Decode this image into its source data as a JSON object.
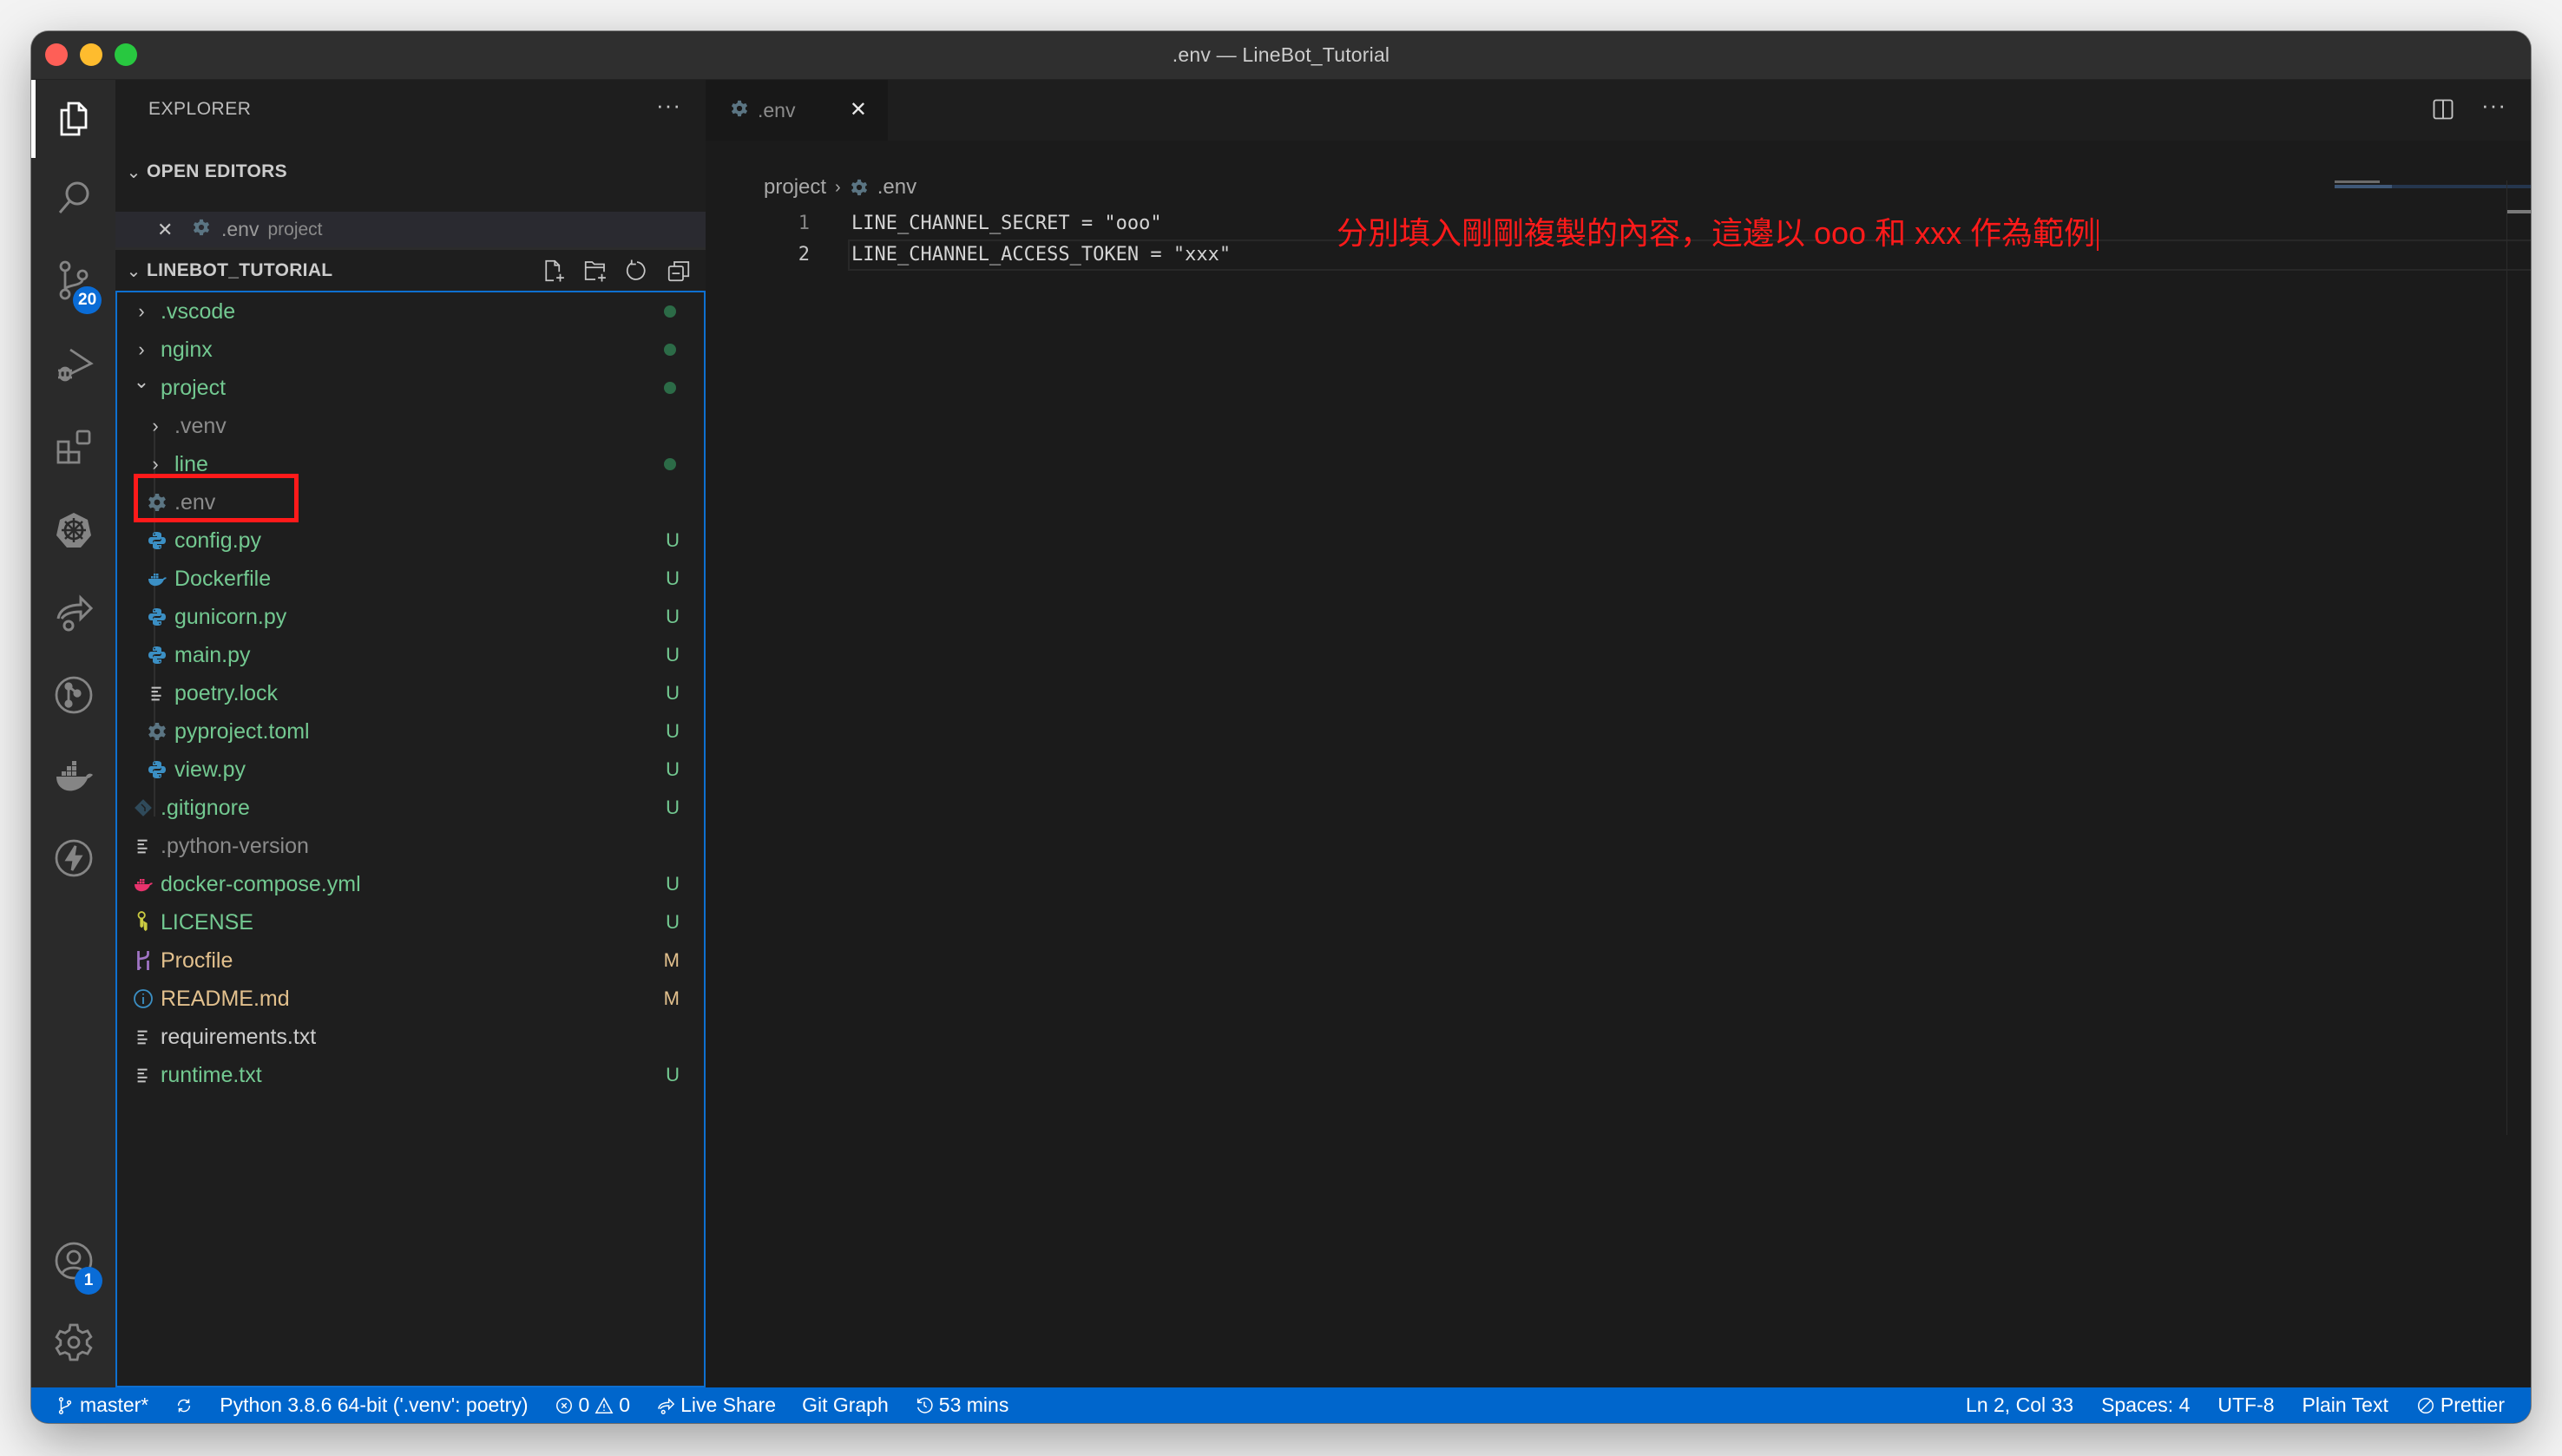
{
  "window": {
    "title": ".env — LineBot_Tutorial"
  },
  "activity_bar": {
    "items": [
      {
        "name": "explorer",
        "icon": "files-icon",
        "active": true
      },
      {
        "name": "search",
        "icon": "search-icon"
      },
      {
        "name": "source-control",
        "icon": "source-control-icon",
        "badge": "20"
      },
      {
        "name": "run-and-debug",
        "icon": "debug-icon"
      },
      {
        "name": "extensions",
        "icon": "extensions-icon"
      },
      {
        "name": "kubernetes",
        "icon": "kubernetes-icon"
      },
      {
        "name": "live-share",
        "icon": "live-share-icon"
      },
      {
        "name": "git-graph",
        "icon": "git-graph-icon"
      },
      {
        "name": "docker",
        "icon": "docker-icon"
      },
      {
        "name": "thunder-client",
        "icon": "lightning-icon"
      }
    ],
    "bottom": [
      {
        "name": "accounts",
        "icon": "account-icon",
        "badge": "1"
      },
      {
        "name": "manage",
        "icon": "gear-icon"
      }
    ]
  },
  "sidebar": {
    "title": "EXPLORER",
    "more": "···",
    "open_editors": {
      "label": "OPEN EDITORS",
      "items": [
        {
          "name": ".env",
          "description": "project",
          "close": "✕"
        }
      ]
    },
    "workspace": {
      "label": "LINEBOT_TUTORIAL",
      "actions": [
        "new-file",
        "new-folder",
        "refresh",
        "collapse-all"
      ],
      "tree": [
        {
          "name": ".vscode",
          "type": "folder",
          "expanded": false,
          "depth": 0,
          "color": "green",
          "decoration": "dot"
        },
        {
          "name": "nginx",
          "type": "folder",
          "expanded": false,
          "depth": 0,
          "color": "green",
          "decoration": "dot"
        },
        {
          "name": "project",
          "type": "folder",
          "expanded": true,
          "depth": 0,
          "color": "green",
          "decoration": "dot"
        },
        {
          "name": ".venv",
          "type": "folder",
          "expanded": false,
          "depth": 1,
          "color": "gray",
          "decoration": ""
        },
        {
          "name": "line",
          "type": "folder",
          "expanded": false,
          "depth": 1,
          "color": "green",
          "decoration": "dot"
        },
        {
          "name": ".env",
          "type": "file",
          "icon": "gear",
          "depth": 1,
          "color": "gray",
          "decoration": "",
          "highlighted": true
        },
        {
          "name": "config.py",
          "type": "file",
          "icon": "python",
          "depth": 1,
          "color": "green",
          "decoration": "U"
        },
        {
          "name": "Dockerfile",
          "type": "file",
          "icon": "docker",
          "depth": 1,
          "color": "green",
          "decoration": "U"
        },
        {
          "name": "gunicorn.py",
          "type": "file",
          "icon": "python",
          "depth": 1,
          "color": "green",
          "decoration": "U"
        },
        {
          "name": "main.py",
          "type": "file",
          "icon": "python",
          "depth": 1,
          "color": "green",
          "decoration": "U"
        },
        {
          "name": "poetry.lock",
          "type": "file",
          "icon": "lines",
          "depth": 1,
          "color": "green",
          "decoration": "U"
        },
        {
          "name": "pyproject.toml",
          "type": "file",
          "icon": "gear",
          "depth": 1,
          "color": "green",
          "decoration": "U"
        },
        {
          "name": "view.py",
          "type": "file",
          "icon": "python",
          "depth": 1,
          "color": "green",
          "decoration": "U"
        },
        {
          "name": ".gitignore",
          "type": "file",
          "icon": "git",
          "depth": 0,
          "color": "green",
          "decoration": "U"
        },
        {
          "name": ".python-version",
          "type": "file",
          "icon": "lines",
          "depth": 0,
          "color": "gray",
          "decoration": ""
        },
        {
          "name": "docker-compose.yml",
          "type": "file",
          "icon": "docker-pink",
          "depth": 0,
          "color": "green",
          "decoration": "U"
        },
        {
          "name": "LICENSE",
          "type": "file",
          "icon": "key",
          "depth": 0,
          "color": "green",
          "decoration": "U"
        },
        {
          "name": "Procfile",
          "type": "file",
          "icon": "heroku",
          "depth": 0,
          "color": "orange",
          "decoration": "M"
        },
        {
          "name": "README.md",
          "type": "file",
          "icon": "info",
          "depth": 0,
          "color": "orange",
          "decoration": "M"
        },
        {
          "name": "requirements.txt",
          "type": "file",
          "icon": "lines",
          "depth": 0,
          "color": "white",
          "decoration": ""
        },
        {
          "name": "runtime.txt",
          "type": "file",
          "icon": "lines",
          "depth": 0,
          "color": "green",
          "decoration": "U"
        }
      ]
    }
  },
  "editor": {
    "tab": {
      "label": ".env",
      "close": "✕"
    },
    "actions": {
      "split": "split-editor-icon",
      "more": "···"
    },
    "breadcrumb": [
      "project",
      ".env"
    ],
    "lines": [
      {
        "number": "1",
        "text": "LINE_CHANNEL_SECRET = \"ooo\""
      },
      {
        "number": "2",
        "text": "LINE_CHANNEL_ACCESS_TOKEN = \"xxx\""
      }
    ],
    "annotation": "分別填入剛剛複製的內容，這邊以 ooo 和 xxx 作為範例"
  },
  "statusbar": {
    "branch": "master*",
    "python": "Python 3.8.6 64-bit ('.venv': poetry)",
    "errors": "0",
    "warnings": "0",
    "live_share": "Live Share",
    "git_graph": "Git Graph",
    "time": "53 mins",
    "position": "Ln 2, Col 33",
    "spaces": "Spaces: 4",
    "encoding": "UTF-8",
    "language": "Plain Text",
    "prettier": "Prettier"
  },
  "colors": {
    "accent": "#0066cc",
    "git_untracked": "#73c991",
    "git_modified": "#e2c08d",
    "annotation": "#ff1a1a",
    "badge": "#0a6cd6"
  }
}
